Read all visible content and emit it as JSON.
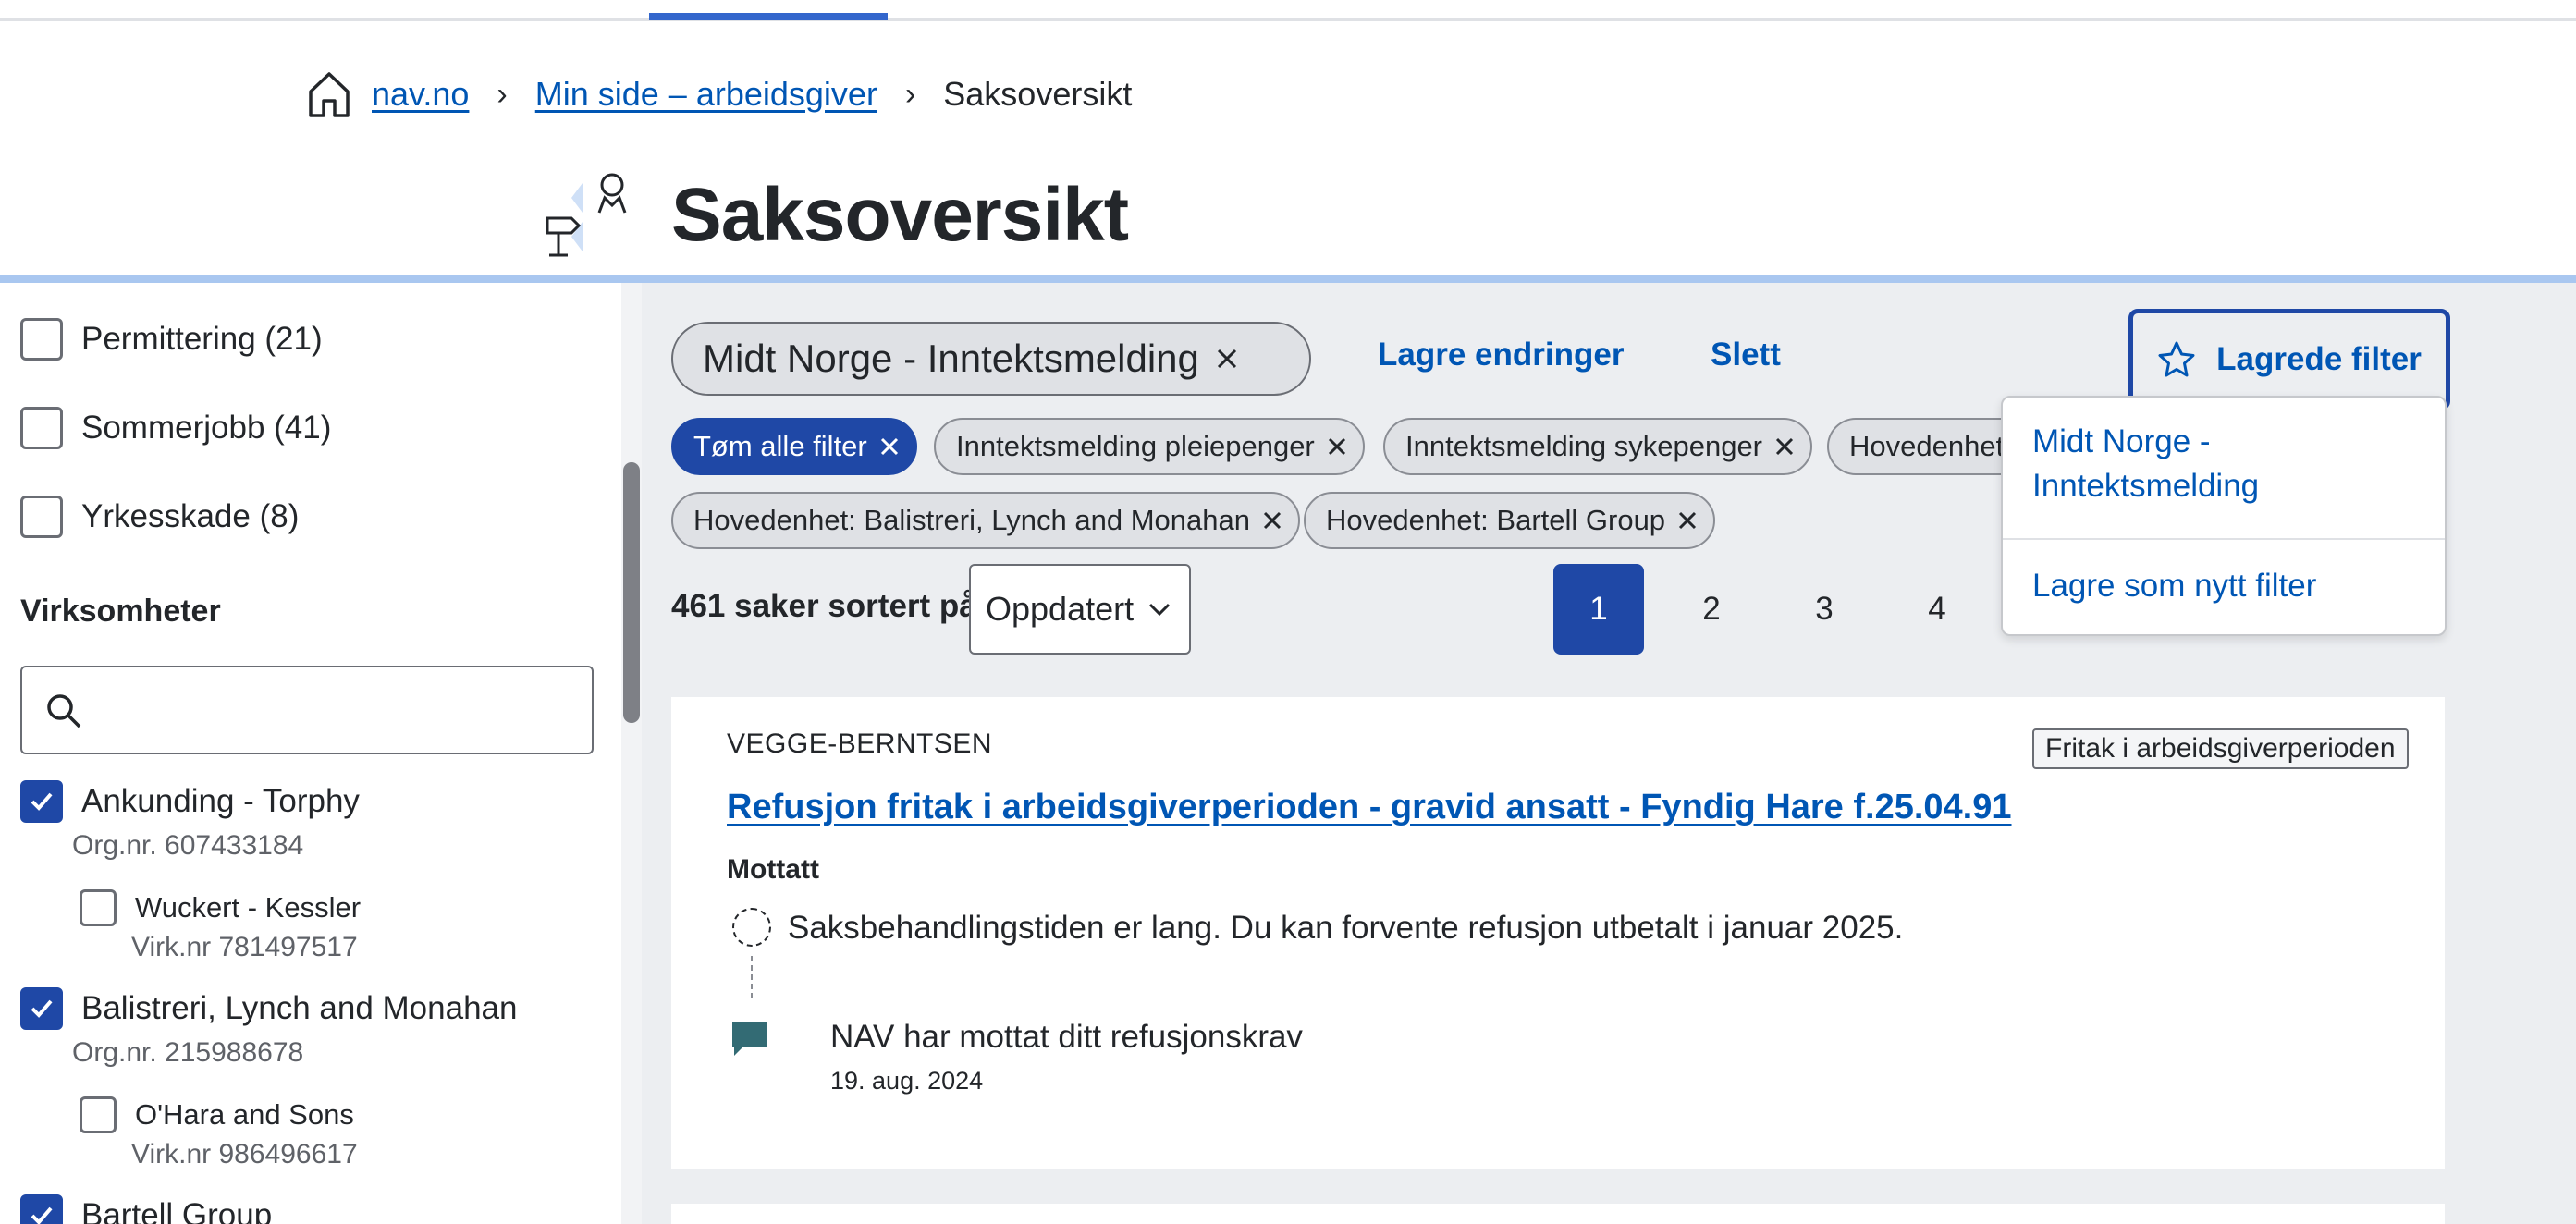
{
  "breadcrumb": {
    "items": [
      "nav.no",
      "Min side – arbeidsgiver"
    ],
    "current": "Saksoversikt",
    "separator": "›"
  },
  "header": {
    "title": "Saksoversikt"
  },
  "sidebar": {
    "types": [
      {
        "label": "Permittering (21)",
        "checked": false
      },
      {
        "label": "Sommerjobb (41)",
        "checked": false
      },
      {
        "label": "Yrkesskade (8)",
        "checked": false
      }
    ],
    "section_title": "Virksomheter",
    "search": {
      "value": "",
      "placeholder": ""
    },
    "orgs": [
      {
        "name": "Ankunding - Torphy",
        "sub": "Org.nr. 607433184",
        "checked": true
      },
      {
        "name": "Wuckert - Kessler",
        "sub": "Virk.nr 781497517",
        "checked": false
      },
      {
        "name": "Balistreri, Lynch and Monahan",
        "sub": "Org.nr. 215988678",
        "checked": true
      },
      {
        "name": "O'Hara and Sons",
        "sub": "Virk.nr 986496617",
        "checked": false
      },
      {
        "name": "Bartell Group",
        "sub": "",
        "checked": true
      }
    ]
  },
  "toolbar": {
    "active_filter": "Midt Norge - Inntektsmelding",
    "save_changes": "Lagre endringer",
    "delete": "Slett",
    "saved_filters": "Lagrede filter"
  },
  "chips": {
    "clear_all": "Tøm alle filter",
    "items": [
      "Inntektsmelding pleiepenger",
      "Inntektsmelding sykepenger",
      "Hovedenhet",
      "Hovedenhet: Balistreri, Lynch and Monahan",
      "Hovedenhet: Bartell Group"
    ]
  },
  "results": {
    "count_text": "461 saker sortert på",
    "sort_value": "Oppdatert"
  },
  "pagination": {
    "pages": [
      "1",
      "2",
      "3",
      "4"
    ],
    "current": "1"
  },
  "dropdown": {
    "items": [
      "Midt Norge - Inntektsmelding",
      "Lagre som nytt filter"
    ]
  },
  "card": {
    "org": "VEGGE-BERNTSEN",
    "tag": "Fritak i arbeidsgiverperioden",
    "title": "Refusjon fritak i arbeidsgiverperioden - gravid ansatt - Fyndig Hare f.25.04.91",
    "status": "Mottatt",
    "timeline": [
      {
        "text": "Saksbehandlingstiden er lang. Du kan forvente refusjon utbetalt i januar 2025.",
        "date": ""
      },
      {
        "text": "NAV har mottat ditt refusjonskrav",
        "date": "19. aug. 2024"
      }
    ]
  },
  "colors": {
    "primary": "#1f48a6",
    "link": "#0056b4",
    "chip_bg": "#dfe1e5",
    "main_bg": "#eceef1",
    "header_line": "#a9c7f0"
  }
}
